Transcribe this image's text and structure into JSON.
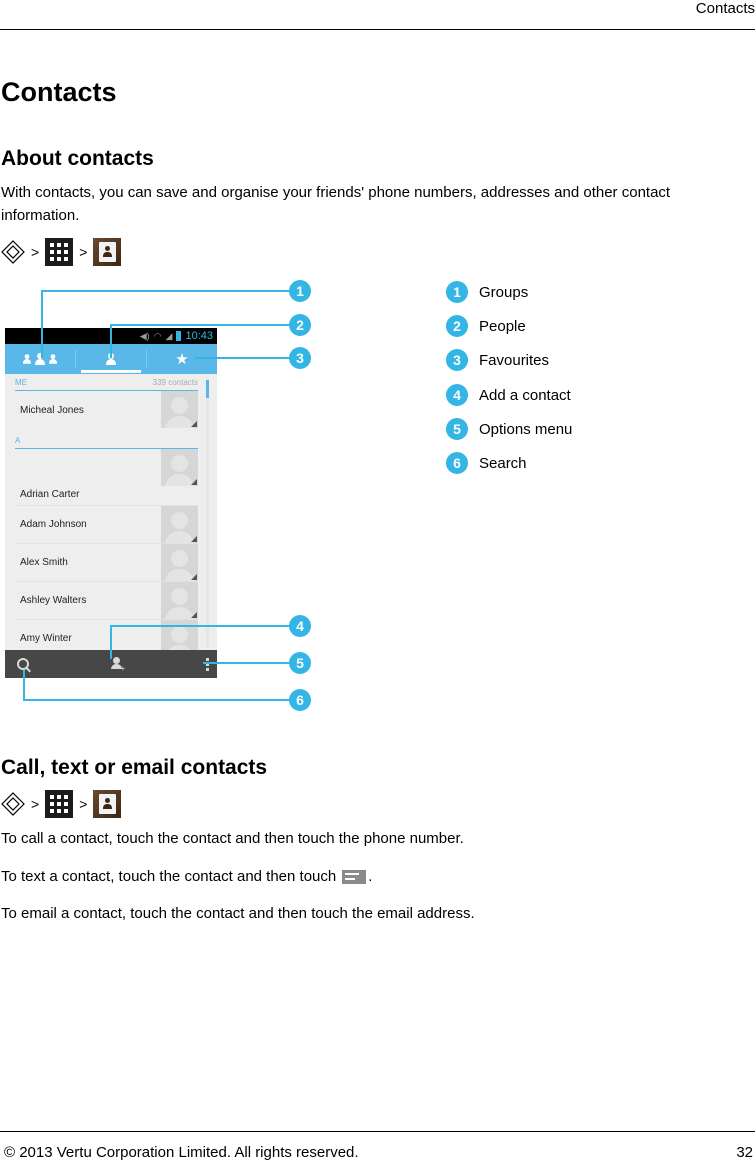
{
  "running_header": "Contacts",
  "page_title": "Contacts",
  "section1": {
    "heading": "About contacts",
    "paragraph": "With contacts, you can save and organise your friends' phone numbers, addresses and other contact information.",
    "nav_path": {
      "icons": [
        "vertu-key-icon",
        "apps-grid-icon",
        "contacts-app-icon"
      ],
      "separator": ">"
    }
  },
  "phone": {
    "status_bar": {
      "time": "10:43",
      "icons": [
        "volume-icon",
        "wifi-icon",
        "signal-icon",
        "battery-icon"
      ]
    },
    "tabs": [
      {
        "name": "groups",
        "icon": "groups-icon"
      },
      {
        "name": "people",
        "icon": "person-icon",
        "active": true
      },
      {
        "name": "favourites",
        "icon": "star-icon",
        "glyph": "★"
      }
    ],
    "me_section": {
      "label": "ME",
      "count": "339 contacts"
    },
    "me_contact": "Micheal Jones",
    "a_section": {
      "label": "A"
    },
    "contacts": [
      "Adrian Carter",
      "Adam Johnson",
      "Alex Smith",
      "Ashley Walters",
      "Amy Winter"
    ],
    "bottom_bar": [
      "search-icon",
      "add-contact-icon",
      "overflow-menu-icon"
    ]
  },
  "legend": [
    {
      "num": "1",
      "label": "Groups"
    },
    {
      "num": "2",
      "label": "People"
    },
    {
      "num": "3",
      "label": "Favourites"
    },
    {
      "num": "4",
      "label": "Add a contact"
    },
    {
      "num": "5",
      "label": "Options menu"
    },
    {
      "num": "6",
      "label": "Search"
    }
  ],
  "section2": {
    "heading": "Call, text or email contacts",
    "p_call": "To call a contact, touch the contact and then touch the phone number.",
    "p_text_before": "To text a contact, touch the contact and then touch",
    "p_text_after": ".",
    "p_email": "To email a contact, touch the contact and then touch the email address."
  },
  "footer": {
    "copyright": "© 2013 Vertu Corporation Limited. All rights reserved.",
    "page_number": "32"
  },
  "colors": {
    "accent": "#33b5e5",
    "tab_bar": "#5ab8e8",
    "bottom_bar": "#474747"
  }
}
